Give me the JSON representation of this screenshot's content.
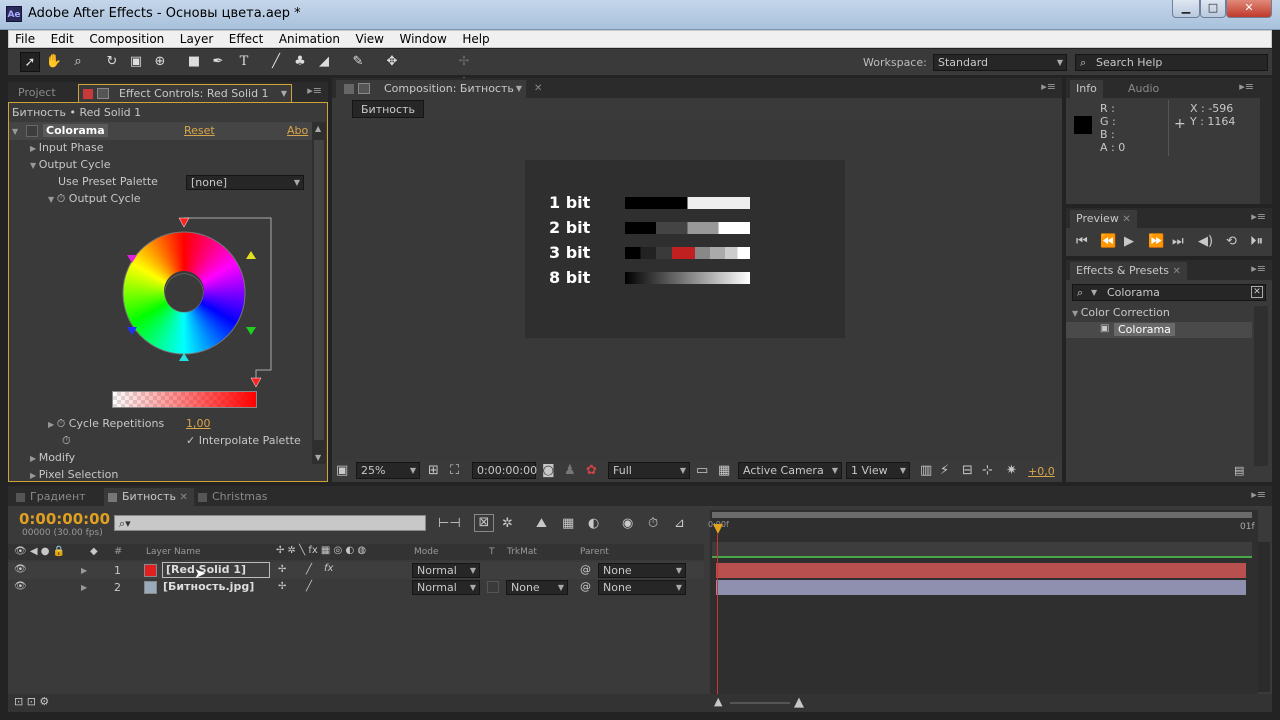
{
  "window": {
    "title": "Adobe After Effects - Основы цвета.aep *",
    "app_icon": "Ae"
  },
  "menu": [
    "File",
    "Edit",
    "Composition",
    "Layer",
    "Effect",
    "Animation",
    "View",
    "Window",
    "Help"
  ],
  "toolbar": {
    "workspace_label": "Workspace:",
    "workspace_value": "Standard",
    "search_placeholder": "Search Help"
  },
  "left_panel": {
    "tabs": [
      "Project",
      "Effect Controls: Red Solid 1"
    ],
    "breadcrumb": "Битность • Red Solid 1",
    "effect_name": "Colorama",
    "reset": "Reset",
    "about": "Abo",
    "input_phase": "Input Phase",
    "output_cycle": "Output Cycle",
    "use_preset_palette": "Use Preset Palette",
    "preset_value": "[none]",
    "output_cycle_sub": "Output Cycle",
    "cycle_repetitions": "Cycle Repetitions",
    "cycle_value": "1,00",
    "interpolate_palette": "Interpolate Palette",
    "modify": "Modify",
    "pixel_selection": "Pixel Selection"
  },
  "comp_panel": {
    "tab": "Composition: Битность",
    "comp_button": "Битность",
    "bits": [
      "1 bit",
      "2 bit",
      "3 bit",
      "8 bit"
    ],
    "zoom": "25%",
    "timecode": "0:00:00:00",
    "resolution": "Full",
    "camera": "Active Camera",
    "views": "1 View",
    "exposure": "+0,0"
  },
  "info_panel": {
    "tabs": [
      "Info",
      "Audio"
    ],
    "r": "R :",
    "g": "G :",
    "b": "B :",
    "a": "A : 0",
    "x": "X : -596",
    "y": "Y : 1164"
  },
  "preview_panel": {
    "tab": "Preview"
  },
  "effects_panel": {
    "tab": "Effects & Presets",
    "search": "Colorama",
    "category": "Color Correction",
    "item": "Colorama"
  },
  "timeline": {
    "tabs": [
      "Градиент",
      "Битность",
      "Christmas"
    ],
    "timecode": "0:00:00:00",
    "fps": "00000 (30.00 fps)",
    "columns": {
      "layer_name": "Layer Name",
      "mode": "Mode",
      "t": "T",
      "trkmat": "TrkMat",
      "parent": "Parent",
      "hash": "#"
    },
    "ruler": {
      "start": "0:00f",
      "end": "01f"
    },
    "layers": [
      {
        "num": "1",
        "name": "[Red Solid 1]",
        "mode": "Normal",
        "trkmat": "",
        "parent": "None",
        "color": "#e02020",
        "bar": "#b84a4a"
      },
      {
        "num": "2",
        "name": "[Битность.jpg]",
        "mode": "Normal",
        "trkmat": "None",
        "parent": "None",
        "color": "#9a9ab8",
        "bar": "#8f8fb0"
      }
    ]
  },
  "colors": {
    "accent": "#d8a54a",
    "playhead": "#cc3333",
    "panel": "#3a3a3a",
    "dark": "#232323"
  }
}
